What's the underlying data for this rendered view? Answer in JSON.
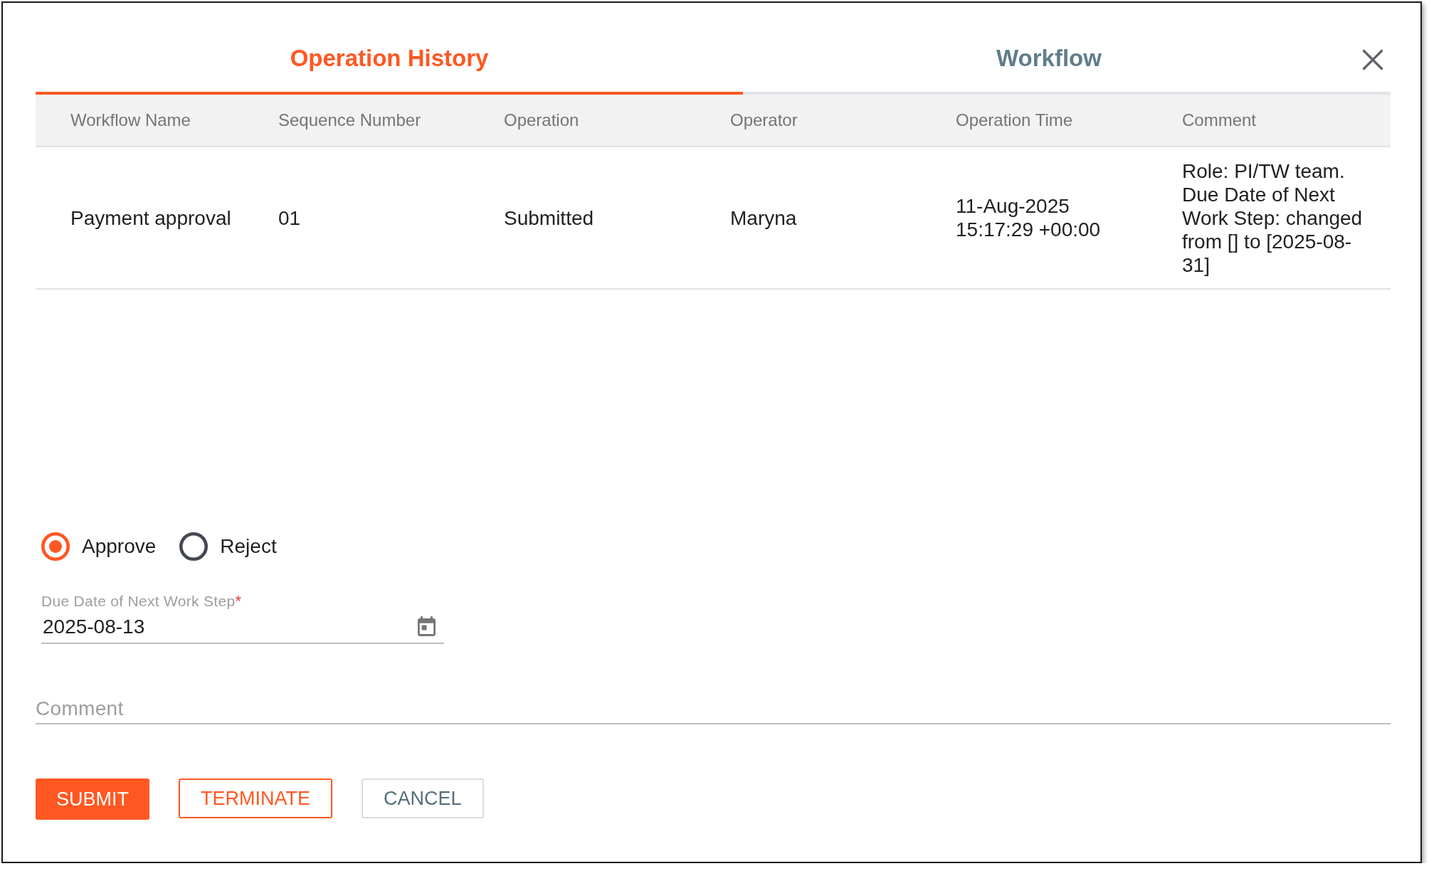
{
  "tabs": [
    {
      "label": "Operation History",
      "selected": true
    },
    {
      "label": "Workflow",
      "selected": false
    }
  ],
  "table": {
    "columns": [
      "Workflow Name",
      "Sequence Number",
      "Operation",
      "Operator",
      "Operation Time",
      "Comment"
    ],
    "rows": [
      {
        "cells": [
          "Payment approval",
          "01",
          "Submitted",
          "Maryna",
          "11-Aug-2025 15:17:29 +00:00",
          "Role: PI/TW team. Due Date of Next Work Step: changed from [] to [2025-08-31]"
        ]
      }
    ]
  },
  "decision": {
    "options": [
      {
        "label": "Approve",
        "selected": true
      },
      {
        "label": "Reject",
        "selected": false
      }
    ]
  },
  "due_date": {
    "label": "Due Date of Next Work Step",
    "required_mark": "*",
    "value": "2025-08-13"
  },
  "comment": {
    "placeholder": "Comment"
  },
  "buttons": [
    {
      "label": "SUBMIT",
      "kind": "primary"
    },
    {
      "label": "TERMINATE",
      "kind": "outlined"
    },
    {
      "label": "CANCEL",
      "kind": "plain"
    }
  ]
}
